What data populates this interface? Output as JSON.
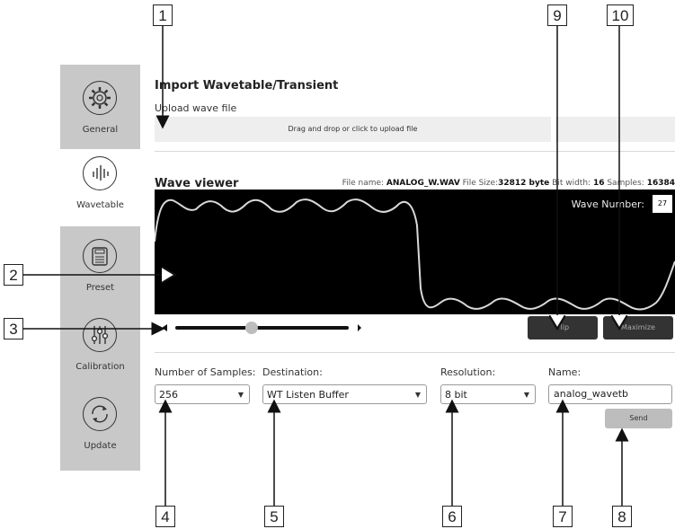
{
  "sidebar": {
    "items": [
      {
        "label": "General",
        "icon": "gear-icon",
        "active": false
      },
      {
        "label": "Wavetable",
        "icon": "waveform-icon",
        "active": true
      },
      {
        "label": "Preset",
        "icon": "preset-icon",
        "active": false
      },
      {
        "label": "Calibration",
        "icon": "sliders-icon",
        "active": false
      },
      {
        "label": "Update",
        "icon": "update-icon",
        "active": false
      }
    ]
  },
  "import": {
    "title": "Import Wavetable/Transient",
    "upload_label": "Upload wave file",
    "dropzone_text": "Drag and drop or click to upload file"
  },
  "viewer": {
    "title": "Wave viewer",
    "file_name_label": "File name:",
    "file_name": "ANALOG_W.WAV",
    "file_size_label": "File Size:",
    "file_size": "32812 byte",
    "bit_width_label": "Bit width:",
    "bit_width": "16",
    "samples_label": "Samples:",
    "samples": "16384",
    "wave_number_label": "Wave Number:",
    "wave_number": "27",
    "slider_value": 0.44
  },
  "buttons": {
    "flip": "Flip",
    "maximize": "Maximize",
    "send": "Send"
  },
  "fields": {
    "num_samples_label": "Number of Samples:",
    "num_samples_value": "256",
    "destination_label": "Destination:",
    "destination_value": "WT Listen Buffer",
    "resolution_label": "Resolution:",
    "resolution_value": "8 bit",
    "name_label": "Name:",
    "name_value": "analog_wavetb"
  },
  "callouts": {
    "c1": "1",
    "c2": "2",
    "c3": "3",
    "c4": "4",
    "c5": "5",
    "c6": "6",
    "c7": "7",
    "c8": "8",
    "c9": "9",
    "c10": "10"
  },
  "colors": {
    "sidebar_bg": "#c8c8c8",
    "viewer_bg": "#000000",
    "dark_button": "#333333",
    "send_button": "#bdbdbd"
  }
}
